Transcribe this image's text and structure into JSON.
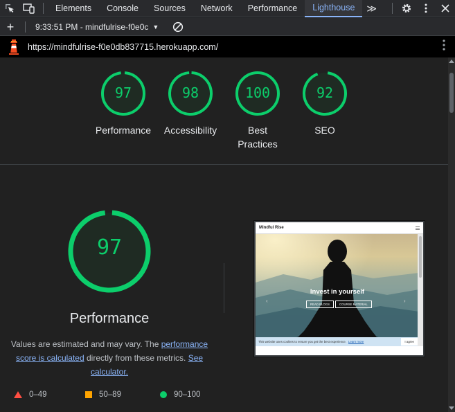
{
  "devtools": {
    "tabs": [
      "Elements",
      "Console",
      "Sources",
      "Network",
      "Performance",
      "Lighthouse"
    ],
    "active_tab": "Lighthouse",
    "more_tabs_glyph": "≫"
  },
  "toolbar": {
    "run_label": "9:33:51 PM - mindfulrise-f0e0c"
  },
  "url_bar": {
    "url": "https://mindfulrise-f0e0db837715.herokuapp.com/"
  },
  "summary_gauges": [
    {
      "score": "97",
      "label": "Performance"
    },
    {
      "score": "98",
      "label": "Accessibility"
    },
    {
      "score": "100",
      "label_line1": "Best",
      "label_line2": "Practices"
    },
    {
      "score": "92",
      "label": "SEO"
    }
  ],
  "performance": {
    "score": "97",
    "title": "Performance",
    "desc_text1": "Values are estimated and may vary. The ",
    "desc_link1": "performance score is calculated",
    "desc_text2": " directly from these metrics. ",
    "desc_link2": "See calculator."
  },
  "legend": [
    {
      "range": "0–49",
      "shape": "triangle",
      "color": "#ff4e42"
    },
    {
      "range": "50–89",
      "shape": "square",
      "color": "#ffa400"
    },
    {
      "range": "90–100",
      "shape": "circle",
      "color": "#0cce6b"
    }
  ],
  "thumbnail": {
    "site_name": "Mindful Rise",
    "hero_title": "Invest in yourself",
    "button1": "READ BLOGS",
    "button2": "COURSE MATERIAL",
    "cookie_text": "This website uses cookies to ensure you get the best experience.",
    "cookie_link": "Learn more",
    "cookie_button": "I agree"
  },
  "colors": {
    "pass": "#0cce6b",
    "accent": "#8ab4f8",
    "background": "#212121"
  }
}
